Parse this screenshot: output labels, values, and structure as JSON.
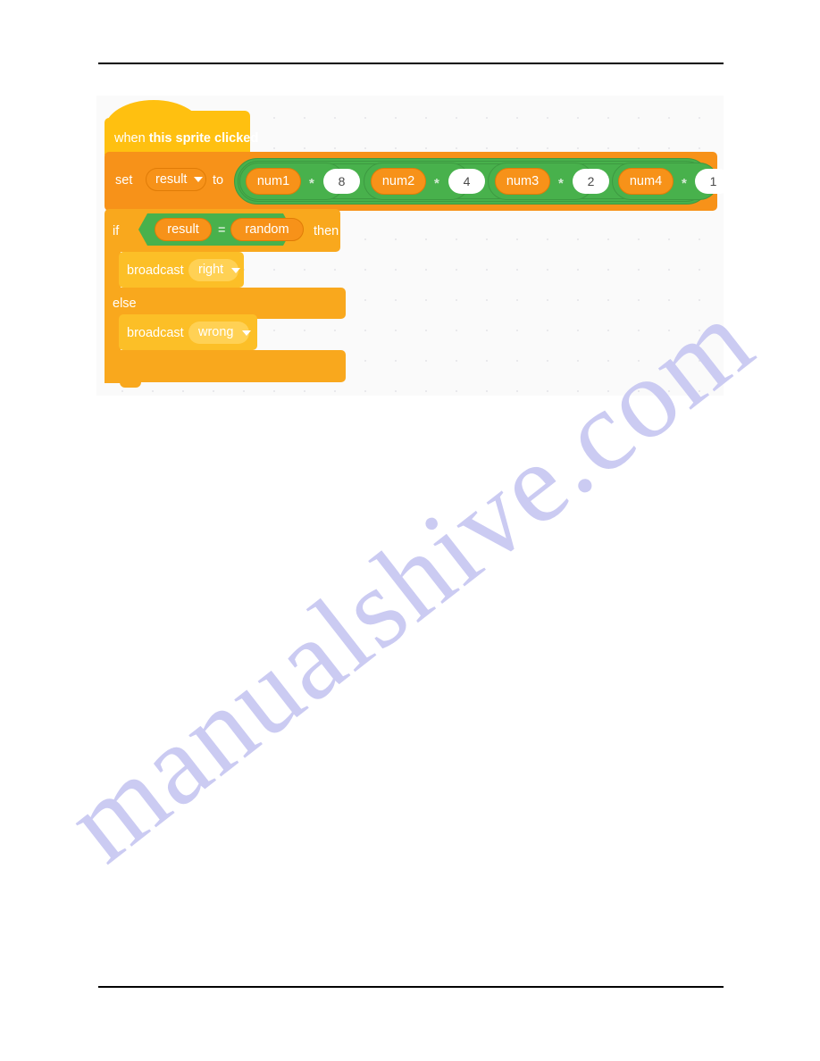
{
  "page": {
    "watermark": "manualshive.com",
    "header_rule": true,
    "footer_rule": true
  },
  "scratch": {
    "hat": {
      "label_when": "when ",
      "label_bold": "this sprite clicked",
      "full_label": "when this sprite clicked",
      "color": "#ffc010"
    },
    "set_block": {
      "set_label": "set",
      "variable": "result",
      "to_label": "to",
      "color": "#f79219"
    },
    "expression": {
      "operator_color": "#48b14c",
      "variable_color": "#f79219",
      "terms": [
        {
          "variable": "num1",
          "operator": "*",
          "value": "8"
        },
        {
          "variable": "num2",
          "operator": "*",
          "value": "4"
        },
        {
          "variable": "num3",
          "operator": "*",
          "value": "2"
        },
        {
          "variable": "num4",
          "operator": "*",
          "value": "1"
        }
      ],
      "joiners": [
        "+",
        "+",
        "+"
      ]
    },
    "if_block": {
      "if_label": "if",
      "then_label": "then",
      "else_label": "else",
      "color": "#f9a81d",
      "condition": {
        "left": "result",
        "operator": "=",
        "right": "random"
      }
    },
    "broadcasts": [
      {
        "label": "broadcast",
        "message": "right"
      },
      {
        "label": "broadcast",
        "message": "wrong"
      }
    ]
  }
}
